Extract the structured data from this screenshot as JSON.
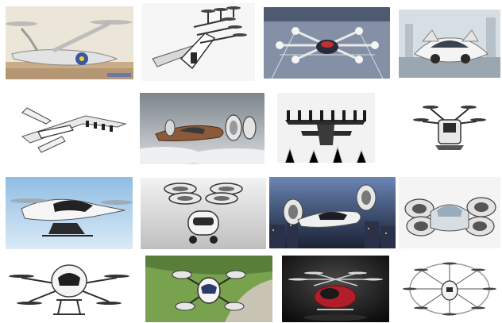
{
  "collage": {
    "rows": 4,
    "columns": 4,
    "tiles": [
      {
        "id": 1,
        "subject": "tilt-rotor-aircraft-over-desert",
        "background": "#e9dcc4"
      },
      {
        "id": 2,
        "subject": "multicopter-winged-aircraft-sketch",
        "background": "#f4f4f4"
      },
      {
        "id": 3,
        "subject": "multirotor-vehicle-on-landing-pad",
        "background": "#7f8ea3"
      },
      {
        "id": 4,
        "subject": "flying-car-concept-city",
        "background": "#cfd8de"
      },
      {
        "id": 5,
        "subject": "tilt-wing-aircraft-white",
        "background": "#ffffff"
      },
      {
        "id": 6,
        "subject": "bronze-ducted-fan-aircraft-clouds",
        "background": "#aab2b8"
      },
      {
        "id": 7,
        "subject": "dark-distributed-propulsion-aircraft",
        "background": "#f2f2f2"
      },
      {
        "id": 8,
        "subject": "compact-multirotor-top-view",
        "background": "#ffffff"
      },
      {
        "id": 9,
        "subject": "white-passenger-drone-blue-sky",
        "background": "#b9d6ee"
      },
      {
        "id": 10,
        "subject": "quad-ducted-fan-pod",
        "background": "#e3e3e3"
      },
      {
        "id": 11,
        "subject": "ducted-fan-flying-car-city-night",
        "background": "#3d4d6c"
      },
      {
        "id": 12,
        "subject": "quad-ducted-fan-car-concept",
        "background": "#f3f3f3"
      },
      {
        "id": 13,
        "subject": "white-octocopter-passenger-drone",
        "background": "#ffffff"
      },
      {
        "id": 14,
        "subject": "quadcopter-over-green-field",
        "background": "#6f9a4a"
      },
      {
        "id": 15,
        "subject": "red-multicopter-dark-studio",
        "background": "#1a1a1a"
      },
      {
        "id": 16,
        "subject": "multirotor-passenger-vehicle-ring",
        "background": "#ffffff"
      }
    ]
  },
  "colors": {
    "page_background": "#ffffff",
    "aircraft_white": "#f2f2f2",
    "aircraft_dark": "#2b2b2b",
    "accent_red": "#b01e2a",
    "accent_bronze": "#8a5a3a",
    "accent_blue": "#2a4a7a"
  }
}
